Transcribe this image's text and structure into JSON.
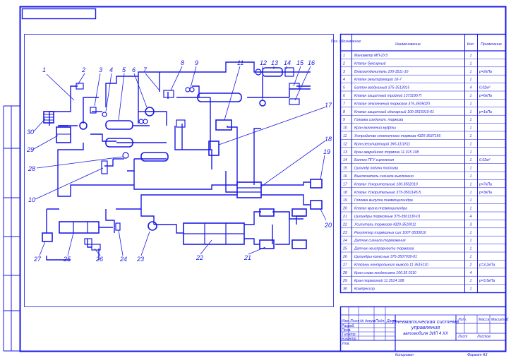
{
  "table": {
    "headers": [
      "Поз. обозначение",
      "Наименование",
      "Кол.",
      "Примечание"
    ],
    "rows": [
      [
        "1",
        "Манометр МП-2УЗ",
        "1",
        ""
      ],
      [
        "2",
        "Клапан буксирный",
        "1",
        ""
      ],
      [
        "3",
        "Влагоотделитель 100-3511-10",
        "1",
        "р=2кПа"
      ],
      [
        "4",
        "Клапан регулирующий 1К-7",
        "1",
        ""
      ],
      [
        "5",
        "Баллон воздушный 375-3513015",
        "4",
        "0,02м³"
      ],
      [
        "6",
        "Клапан защитный тройной 1373190 П",
        "1",
        "р=6кПа"
      ],
      [
        "7",
        "Клапан отключения тормозов 375-3505020",
        "1",
        ""
      ],
      [
        "8",
        "Клапан защитный одинарный 100-3515010-01",
        "1",
        "р=1кПа"
      ],
      [
        "9",
        "Головка соединит. тормоза",
        "1",
        ""
      ],
      [
        "10",
        "Кран включения муфты",
        "1",
        ""
      ],
      [
        "11",
        "Устройство стояночного тормоза 4320-3537156",
        "1",
        ""
      ],
      [
        "12",
        "Кран регулирующий 1К6-11(1К1)",
        "1",
        ""
      ],
      [
        "13",
        "Кран аварийного тормоза 11.315 108",
        "1",
        ""
      ],
      [
        "14",
        "Баллон ПГУ сцепления",
        "1",
        "0,02м³"
      ],
      [
        "15",
        "Цилиндр подачи топлива",
        "1",
        ""
      ],
      [
        "16",
        "Выключатель сигнала выключено",
        "1",
        ""
      ],
      [
        "17",
        "Клапан Ускорительный 100.3562010",
        "1",
        "р=7кПа"
      ],
      [
        "18",
        "Клапан Ускорительный 375-3501145 Б",
        "1",
        "р=3кПа"
      ],
      [
        "19",
        "Головка выпуска пневмоцилиндра",
        "1",
        ""
      ],
      [
        "20",
        "Клапан крана пневмоцилиндра",
        "1",
        ""
      ],
      [
        "21",
        "Цилиндры тормозные 375-3501130-01",
        "4",
        ""
      ],
      [
        "22",
        "Усилитель тормозов 4320-3510011",
        "3",
        ""
      ],
      [
        "23",
        "Регулятор тормозных сил 100Т-3533010",
        "1",
        ""
      ],
      [
        "24",
        "Датчик сигнала торможения",
        "1",
        ""
      ],
      [
        "25",
        "Датчик неисправности тормозов",
        "1",
        ""
      ],
      [
        "26",
        "Цилиндры колесные 375-3507030-01",
        "1",
        ""
      ],
      [
        "27",
        "Клапаны контрольного вывода 11.3515110",
        "2",
        "р=3,2кПа"
      ],
      [
        "28",
        "Кран слива конденсата 100.35 0110",
        "4",
        ""
      ],
      [
        "29",
        "Кран тормозной 11.3514 108",
        "1",
        "р=3,5кПа"
      ],
      [
        "30",
        "Компрессор",
        "1",
        ""
      ]
    ]
  },
  "title_block": {
    "title_lines": [
      "Пневматическая система",
      "управления",
      "автомобиля ЗИЛ 4 ХХ"
    ],
    "stage_header": "Лит.",
    "mass_header": "Масса",
    "scale_header": "Масштаб",
    "sheet_label": "Лист",
    "sheets_label": "Листов",
    "change_labels": [
      "Изм.",
      "Лист",
      "№ докум.",
      "Подп.",
      "Дата"
    ],
    "role_labels": [
      "Разраб.",
      "Пров.",
      "Т.контр.",
      "Н.контр.",
      "Утв."
    ],
    "copied_label": "Копировал",
    "format_label": "Формат   А3"
  },
  "callouts": [
    "1",
    "2",
    "3",
    "4",
    "5",
    "6",
    "7",
    "8",
    "9",
    "10",
    "11",
    "12",
    "13",
    "14",
    "15",
    "16",
    "17",
    "18",
    "19",
    "20",
    "21",
    "22",
    "23",
    "24",
    "25",
    "26",
    "27",
    "28",
    "29",
    "30"
  ],
  "colors": {
    "line": "#1a1ae6",
    "background": "#ffffff"
  }
}
